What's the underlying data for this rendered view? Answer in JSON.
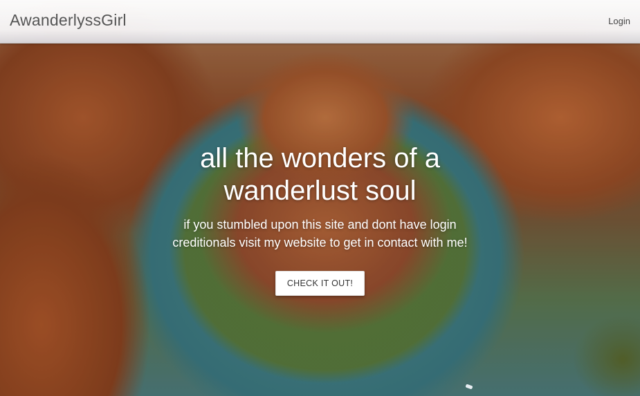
{
  "navbar": {
    "brand": "AwanderlyssGirl",
    "login_label": "Login"
  },
  "hero": {
    "headline": "all the wonders of a wanderlust soul",
    "subtext": "if you stumbled upon this site and dont have login creditionals visit my website to get in contact with me!",
    "cta_label": "CHECK IT OUT!"
  },
  "colors": {
    "navbar_bg": "#f8f8fa",
    "brand_text": "#555555",
    "hero_text": "#ffffff",
    "button_bg": "#ffffff"
  }
}
